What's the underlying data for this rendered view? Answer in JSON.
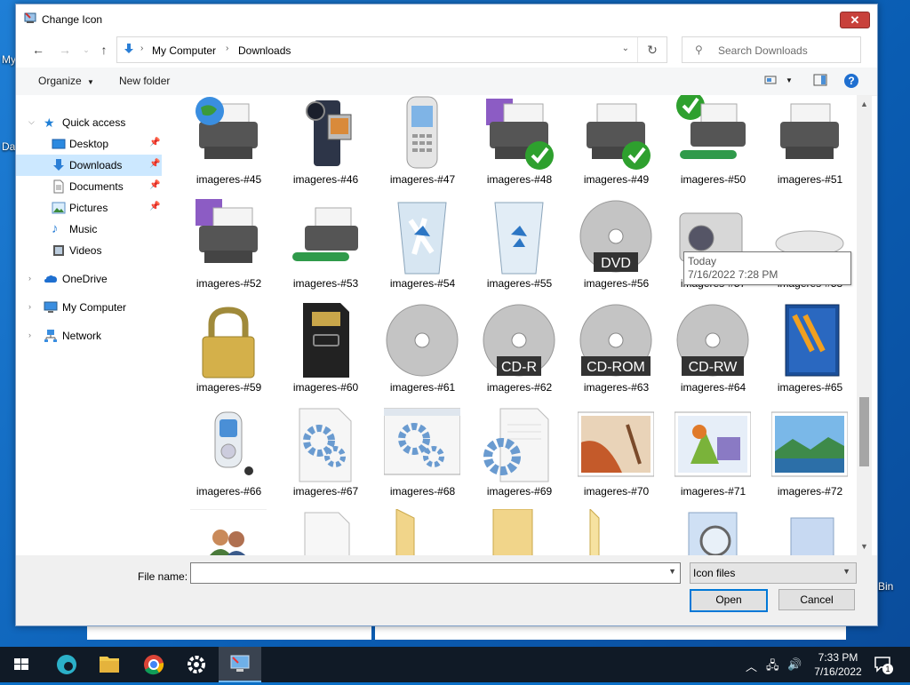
{
  "desktop": {
    "label_top": "My",
    "label_mid": "Da",
    "label_bin": "Bin"
  },
  "dialog": {
    "title": "Change Icon",
    "close_glyph": "✕",
    "address": {
      "crumbs": [
        "My Computer",
        "Downloads"
      ]
    },
    "search_placeholder": "Search Downloads",
    "toolbar": {
      "organize": "Organize",
      "new_folder": "New folder",
      "help": "?"
    },
    "nav": {
      "quick_access": "Quick access",
      "items": [
        "Desktop",
        "Downloads",
        "Documents",
        "Pictures",
        "Music",
        "Videos"
      ],
      "onedrive": "OneDrive",
      "my_computer": "My Computer",
      "network": "Network"
    },
    "files": [
      "imageres-#45",
      "imageres-#46",
      "imageres-#47",
      "imageres-#48",
      "imageres-#49",
      "imageres-#50",
      "imageres-#51",
      "imageres-#52",
      "imageres-#53",
      "imageres-#54",
      "imageres-#55",
      "imageres-#56",
      "imageres-#57",
      "imageres-#58",
      "imageres-#59",
      "imageres-#60",
      "imageres-#61",
      "imageres-#62",
      "imageres-#63",
      "imageres-#64",
      "imageres-#65",
      "imageres-#66",
      "imageres-#67",
      "imageres-#68",
      "imageres-#69",
      "imageres-#70",
      "imageres-#71",
      "imageres-#72"
    ],
    "disc_labels": {
      "dvd": "DVD",
      "cdr": "CD-R",
      "cdrom": "CD-ROM",
      "cdrw": "CD-RW"
    },
    "tooltip": {
      "line1": "Today",
      "line2": "7/16/2022 7:28 PM"
    },
    "footer": {
      "file_name_label": "File name:",
      "file_name_value": "",
      "file_type": "Icon files",
      "open": "Open",
      "cancel": "Cancel"
    }
  },
  "taskbar": {
    "time": "7:33 PM",
    "date": "7/16/2022",
    "notification_count": "1",
    "apps": [
      "start",
      "edge",
      "file-explorer",
      "chrome",
      "settings",
      "display-settings"
    ]
  }
}
